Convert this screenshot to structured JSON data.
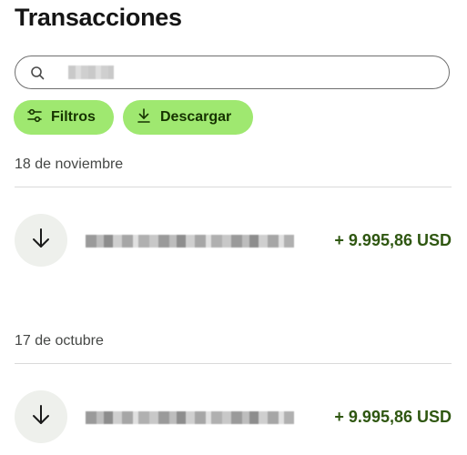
{
  "header": {
    "title": "Transacciones"
  },
  "search": {
    "icon": "search-icon",
    "placeholder": ""
  },
  "actions": {
    "filters_label": "Filtros",
    "filters_icon": "filter-sliders-icon",
    "download_label": "Descargar",
    "download_icon": "download-icon"
  },
  "groups": [
    {
      "date": "18 de noviembre",
      "transactions": [
        {
          "icon": "arrow-down-icon",
          "amount": "+ 9.995,86 USD"
        }
      ]
    },
    {
      "date": "17 de octubre",
      "transactions": [
        {
          "icon": "arrow-down-icon",
          "amount": "+ 9.995,86 USD"
        }
      ]
    }
  ],
  "colors": {
    "accent": "#9fe870",
    "accent_text": "#163300",
    "amount_positive": "#2f5711",
    "icon_bg": "#eef0ec"
  }
}
